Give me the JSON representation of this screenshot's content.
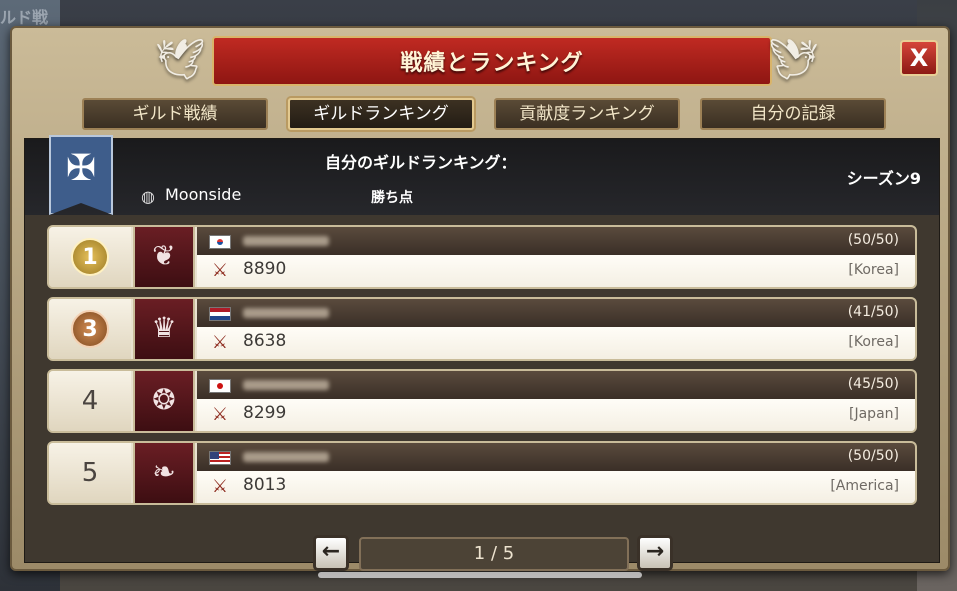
{
  "background": {
    "title": "ルド戦"
  },
  "window": {
    "title": "戦績とランキング",
    "close_label": "X"
  },
  "tabs": [
    {
      "label": "ギルド戦績",
      "active": false
    },
    {
      "label": "ギルドランキング",
      "active": true
    },
    {
      "label": "貢献度ランキング",
      "active": false
    },
    {
      "label": "自分の記録",
      "active": false
    }
  ],
  "my_ranking": {
    "title": "自分のギルドランキング：",
    "guild_name": "Moonside",
    "points_label": "勝ち点",
    "season": "シーズン9"
  },
  "rows": [
    {
      "rank": "1",
      "flag": "kr",
      "members": "(50/50)",
      "score": "8890",
      "region": "[Korea]"
    },
    {
      "rank": "3",
      "flag": "nl",
      "members": "(41/50)",
      "score": "8638",
      "region": "[Korea]"
    },
    {
      "rank": "4",
      "flag": "jp",
      "members": "(45/50)",
      "score": "8299",
      "region": "[Japan]"
    },
    {
      "rank": "5",
      "flag": "us",
      "members": "(50/50)",
      "score": "8013",
      "region": "[America]"
    }
  ],
  "pager": {
    "prev": "←",
    "next": "→",
    "display": "1 / 5"
  },
  "colors": {
    "title_banner": "#a81f1a",
    "panel": "#bba985",
    "row_header": "#4a3d31"
  }
}
